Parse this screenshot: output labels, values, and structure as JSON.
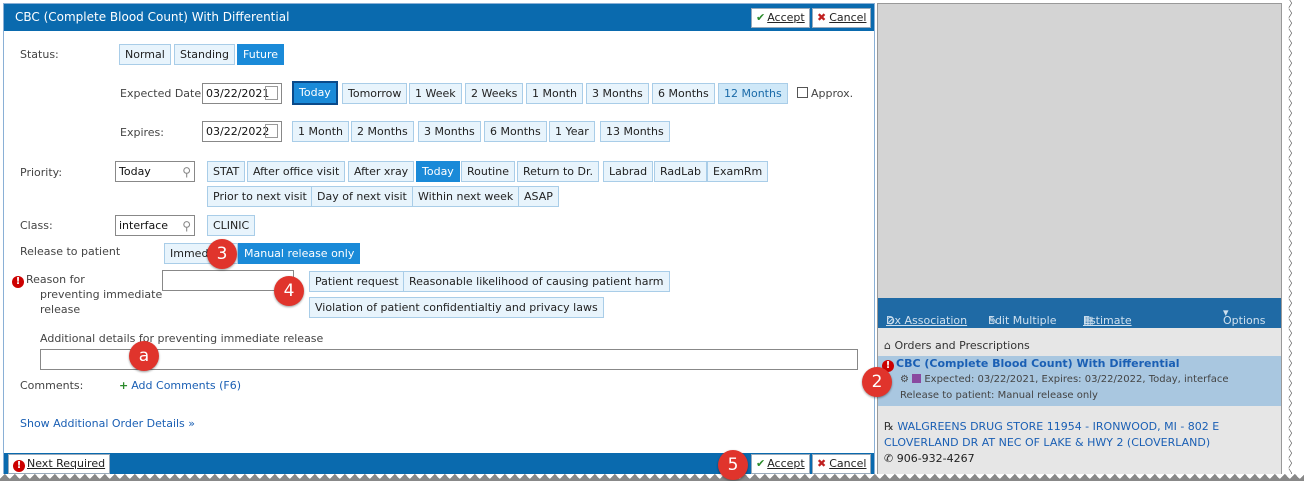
{
  "dialog": {
    "title": "CBC (Complete Blood Count) With Differential",
    "accept": "Accept",
    "cancel": "Cancel"
  },
  "status": {
    "label": "Status:",
    "options": [
      "Normal",
      "Standing",
      "Future"
    ],
    "selected": "Future"
  },
  "expected": {
    "label": "Expected Date:",
    "value": "03/22/2021",
    "options": [
      "Today",
      "Tomorrow",
      "1 Week",
      "2 Weeks",
      "1 Month",
      "3 Months",
      "6 Months",
      "12 Months"
    ],
    "approx": "Approx."
  },
  "expires": {
    "label": "Expires:",
    "value": "03/22/2022",
    "options": [
      "1 Month",
      "2 Months",
      "3 Months",
      "6 Months",
      "1 Year",
      "13 Months"
    ]
  },
  "priority": {
    "label": "Priority:",
    "value": "Today",
    "options_row1": [
      "STAT",
      "After office visit",
      "After xray",
      "Today",
      "Routine",
      "Return to Dr.",
      "Labrad",
      "RadLab",
      "ExamRm"
    ],
    "options_row2": [
      "Prior to next visit",
      "Day of next visit",
      "Within next week",
      "ASAP"
    ]
  },
  "class": {
    "label": "Class:",
    "value": "interface",
    "options": [
      "CLINIC"
    ]
  },
  "release": {
    "label": "Release to patient",
    "options": [
      "Immediate",
      "Manual release only"
    ]
  },
  "reason": {
    "label_line1": "Reason for",
    "label_line2": "preventing immediate",
    "label_line3": "release",
    "options": [
      "Patient request",
      "Reasonable likelihood of causing patient harm",
      "Violation of patient confidentialtiy and privacy laws"
    ]
  },
  "additional": {
    "label": "Additional details for preventing immediate release"
  },
  "comments": {
    "label": "Comments:",
    "add": "Add Comments (F6)"
  },
  "show_details": "Show Additional Order Details",
  "next_required": "Next Required",
  "badges": [
    "3",
    "4",
    "a",
    "2",
    "5"
  ],
  "right": {
    "toolbar": [
      "Dx Association",
      "Edit Multiple",
      "Estimate",
      "Options"
    ],
    "orders_header": "Orders and Prescriptions",
    "order_title": "CBC (Complete Blood Count) With Differential",
    "order_detail": "Expected: 03/22/2021, Expires: 03/22/2022, Today, interface",
    "order_release": "Release to patient: Manual release only",
    "pharmacy_line1": "WALGREENS DRUG STORE 11954 - IRONWOOD, MI - 802 E",
    "pharmacy_line2": "CLOVERLAND DR AT NEC OF LAKE & HWY 2 (CLOVERLAND)",
    "phone": "906-932-4267"
  },
  "colors": {
    "header_blue": "#0a6aae",
    "selected_chip": "#1a8ad8",
    "badge_red": "#e0342c"
  }
}
